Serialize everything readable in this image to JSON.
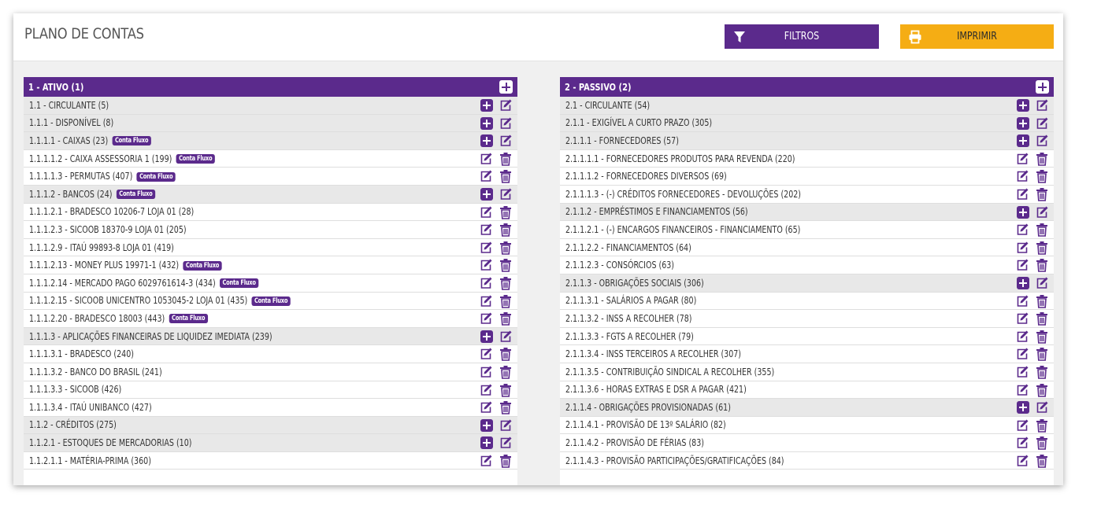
{
  "page": {
    "title": "PLANO DE CONTAS"
  },
  "toolbar": {
    "filtros_label": "FILTROS",
    "imprimir_label": "IMPRIMIR"
  },
  "colors": {
    "accent": "#5b2a8c",
    "print": "#f5ad14",
    "group_bg": "#e8e8e8"
  },
  "badge_text": "Conta Fluxo",
  "icons": {
    "add": "plus-square-icon",
    "edit": "edit-icon",
    "delete": "trash-icon",
    "filter": "filter-icon",
    "print": "printer-icon"
  },
  "panels": [
    {
      "title": "1 - ATIVO (1)",
      "rows": [
        {
          "label": "1.1 - CIRCULANTE (5)",
          "group": true,
          "badge": false
        },
        {
          "label": "1.1.1 - DISPONÍVEL (8)",
          "group": true,
          "badge": false
        },
        {
          "label": "1.1.1.1 - CAIXAS (23)",
          "group": true,
          "badge": true
        },
        {
          "label": "1.1.1.1.2 - CAIXA ASSESSORIA 1 (199)",
          "group": false,
          "badge": true
        },
        {
          "label": "1.1.1.1.3 - PERMUTAS (407)",
          "group": false,
          "badge": true
        },
        {
          "label": "1.1.1.2 - BANCOS (24)",
          "group": true,
          "badge": true
        },
        {
          "label": "1.1.1.2.1 - BRADESCO 10206-7 LOJA 01 (28)",
          "group": false,
          "badge": false
        },
        {
          "label": "1.1.1.2.3 - SICOOB 18370-9 LOJA 01 (205)",
          "group": false,
          "badge": false
        },
        {
          "label": "1.1.1.2.9 - ITAÚ 99893-8 LOJA 01 (419)",
          "group": false,
          "badge": false
        },
        {
          "label": "1.1.1.2.13 - MONEY PLUS 19971-1 (432)",
          "group": false,
          "badge": true
        },
        {
          "label": "1.1.1.2.14 - MERCADO PAGO 6029761614-3 (434)",
          "group": false,
          "badge": true
        },
        {
          "label": "1.1.1.2.15 - SICOOB UNICENTRO 1053045-2 LOJA 01 (435)",
          "group": false,
          "badge": true
        },
        {
          "label": "1.1.1.2.20 - BRADESCO 18003 (443)",
          "group": false,
          "badge": true
        },
        {
          "label": "1.1.1.3 - APLICAÇÕES FINANCEIRAS DE LIQUIDEZ IMEDIATA (239)",
          "group": true,
          "badge": false
        },
        {
          "label": "1.1.1.3.1 - BRADESCO (240)",
          "group": false,
          "badge": false
        },
        {
          "label": "1.1.1.3.2 - BANCO DO BRASIL (241)",
          "group": false,
          "badge": false
        },
        {
          "label": "1.1.1.3.3 - SICOOB (426)",
          "group": false,
          "badge": false
        },
        {
          "label": "1.1.1.3.4 - ITAÚ UNIBANCO (427)",
          "group": false,
          "badge": false
        },
        {
          "label": "1.1.2 - CRÉDITOS (275)",
          "group": true,
          "badge": false
        },
        {
          "label": "1.1.2.1 - ESTOQUES DE MERCADORIAS (10)",
          "group": true,
          "badge": false
        },
        {
          "label": "1.1.2.1.1 - MATÉRIA-PRIMA (360)",
          "group": false,
          "badge": false
        }
      ]
    },
    {
      "title": "2 - PASSIVO (2)",
      "rows": [
        {
          "label": "2.1 - CIRCULANTE (54)",
          "group": true,
          "badge": false
        },
        {
          "label": "2.1.1 - EXIGÍVEL A CURTO PRAZO (305)",
          "group": true,
          "badge": false
        },
        {
          "label": "2.1.1.1 - FORNECEDORES (57)",
          "group": true,
          "badge": false
        },
        {
          "label": "2.1.1.1.1 - FORNECEDORES PRODUTOS PARA REVENDA (220)",
          "group": false,
          "badge": false
        },
        {
          "label": "2.1.1.1.2 - FORNECEDORES DIVERSOS (69)",
          "group": false,
          "badge": false
        },
        {
          "label": "2.1.1.1.3 - (-) CRÉDITOS FORNECEDORES - DEVOLUÇÕES (202)",
          "group": false,
          "badge": false
        },
        {
          "label": "2.1.1.2 - EMPRÉSTIMOS E FINANCIAMENTOS (56)",
          "group": true,
          "badge": false
        },
        {
          "label": "2.1.1.2.1 - (-) ENCARGOS FINANCEIROS - FINANCIAMENTO (65)",
          "group": false,
          "badge": false
        },
        {
          "label": "2.1.1.2.2 - FINANCIAMENTOS (64)",
          "group": false,
          "badge": false
        },
        {
          "label": "2.1.1.2.3 - CONSÓRCIOS (63)",
          "group": false,
          "badge": false
        },
        {
          "label": "2.1.1.3 - OBRIGAÇÕES SOCIAIS (306)",
          "group": true,
          "badge": false
        },
        {
          "label": "2.1.1.3.1 - SALÁRIOS A PAGAR (80)",
          "group": false,
          "badge": false
        },
        {
          "label": "2.1.1.3.2 - INSS A RECOLHER (78)",
          "group": false,
          "badge": false
        },
        {
          "label": "2.1.1.3.3 - FGTS A RECOLHER (79)",
          "group": false,
          "badge": false
        },
        {
          "label": "2.1.1.3.4 - INSS TERCEIROS A RECOLHER (307)",
          "group": false,
          "badge": false
        },
        {
          "label": "2.1.1.3.5 - CONTRIBUIÇÃO SINDICAL A RECOLHER (355)",
          "group": false,
          "badge": false
        },
        {
          "label": "2.1.1.3.6 - HORAS EXTRAS E DSR A PAGAR (421)",
          "group": false,
          "badge": false
        },
        {
          "label": "2.1.1.4 - OBRIGAÇÕES PROVISIONADAS (61)",
          "group": true,
          "badge": false
        },
        {
          "label": "2.1.1.4.1 - PROVISÃO DE 13º SALÁRIO (82)",
          "group": false,
          "badge": false
        },
        {
          "label": "2.1.1.4.2 - PROVISÃO DE FÉRIAS (83)",
          "group": false,
          "badge": false
        },
        {
          "label": "2.1.1.4.3 - PROVISÃO PARTICIPAÇÕES/GRATIFICAÇÕES (84)",
          "group": false,
          "badge": false
        }
      ]
    }
  ]
}
